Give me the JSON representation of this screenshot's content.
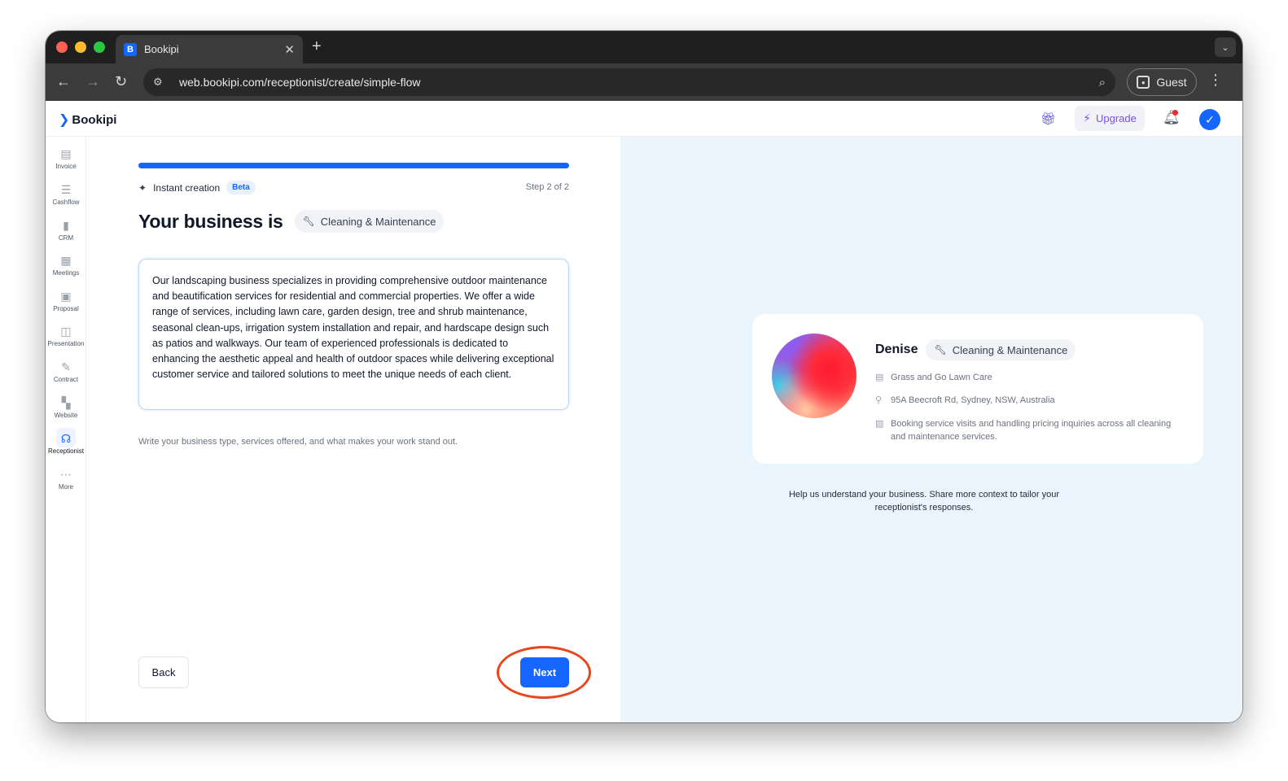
{
  "browser": {
    "tab_title": "Bookipi",
    "tab_favicon": "B",
    "new_tab": "+",
    "url": "web.bookipi.com/receptionist/create/simple-flow",
    "profile_label": "Guest"
  },
  "app": {
    "logo": "Bookipi",
    "upgrade_label": "Upgrade",
    "icons": [
      "gift-icon",
      "bolt-icon",
      "bell-icon",
      "avatar-check-icon"
    ]
  },
  "sidebar": {
    "items": [
      {
        "label": "Invoice",
        "icon": "invoice-icon"
      },
      {
        "label": "Cashflow",
        "icon": "cashflow-icon"
      },
      {
        "label": "CRM",
        "icon": "crm-icon"
      },
      {
        "label": "Meetings",
        "icon": "meetings-icon"
      },
      {
        "label": "Proposal",
        "icon": "proposal-icon"
      },
      {
        "label": "Presentation",
        "icon": "presentation-icon"
      },
      {
        "label": "Contract",
        "icon": "contract-icon"
      },
      {
        "label": "Website",
        "icon": "website-icon"
      },
      {
        "label": "Receptionist",
        "icon": "headset-icon",
        "active": true
      },
      {
        "label": "More",
        "icon": "more-icon"
      }
    ]
  },
  "form": {
    "progress_percent": 100,
    "instant_label": "Instant creation",
    "beta_badge": "Beta",
    "step_label": "Step 2 of 2",
    "heading": "Your business is",
    "category": "Cleaning & Maintenance",
    "description": "Our landscaping business specializes in providing comprehensive outdoor maintenance and beautification services for residential and commercial properties. We offer a wide range of services, including lawn care, garden design, tree and shrub maintenance, seasonal clean-ups, irrigation system installation and repair, and hardscape design such as patios and walkways. Our team of experienced professionals is dedicated to enhancing the aesthetic appeal and health of outdoor spaces while delivering exceptional customer service and tailored solutions to meet the unique needs of each client.",
    "helper": "Write your business type, services offered, and what makes your work stand out.",
    "back_label": "Back",
    "next_label": "Next"
  },
  "preview": {
    "name": "Denise",
    "category": "Cleaning & Maintenance",
    "business_name": "Grass and Go Lawn Care",
    "address": "95A Beecroft Rd, Sydney, NSW, Australia",
    "role": "Booking service visits and handling pricing inquiries across all cleaning and maintenance services.",
    "help_text": "Help us understand your business. Share more context to tailor your receptionist's responses."
  },
  "colors": {
    "accent": "#1565ff",
    "preview_bg": "#eaf5fe",
    "highlight_ring": "#e8461e",
    "upgrade": "#7c4dff"
  }
}
